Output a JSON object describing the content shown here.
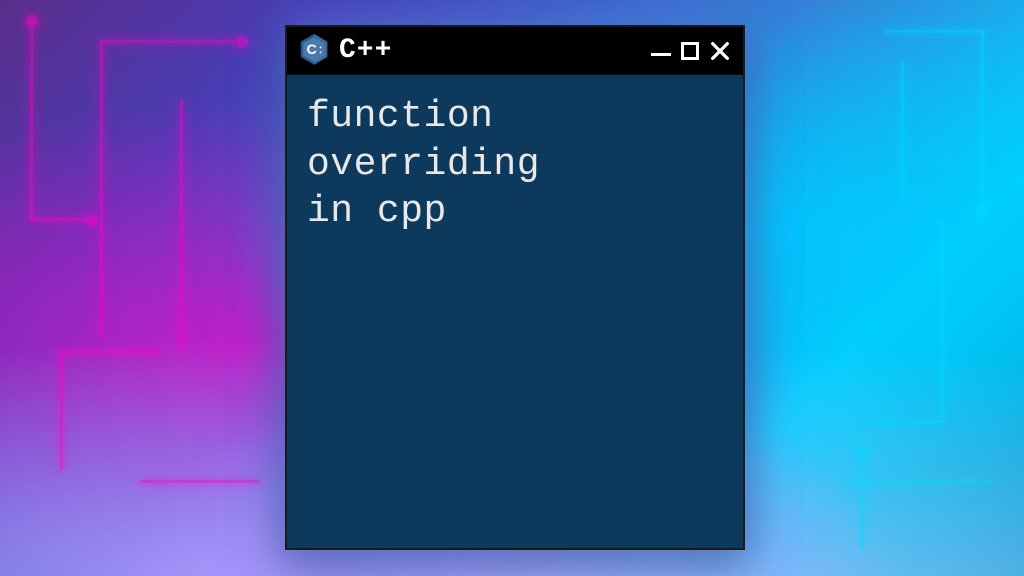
{
  "window": {
    "title": "C++",
    "icon_name": "cpp-logo-icon"
  },
  "terminal": {
    "content": "function\noverriding\nin cpp"
  },
  "colors": {
    "terminal_bg": "#0d3a5c",
    "titlebar_bg": "#000000",
    "text": "#e8e8e8"
  }
}
